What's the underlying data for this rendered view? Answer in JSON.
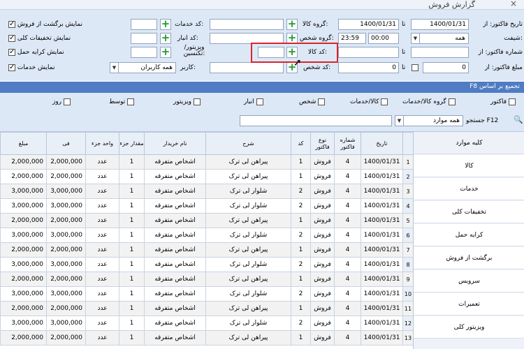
{
  "window": {
    "title": "گزارش فروش",
    "close": "×"
  },
  "filters": {
    "row1": {
      "date_label": "تاریخ فاکتور: از",
      "date_from": "1400/01/31",
      "to_label": "تا",
      "date_to": "1400/01/31",
      "product_group_label": "گروه کالا:",
      "product_group_value": "",
      "service_code_label": "کد خدمات:",
      "service_code_value": ""
    },
    "row2": {
      "shift_label": "شیفت:",
      "shift_value": "همه",
      "time_from": "00:00",
      "time_to": "23:59",
      "person_group_label": "گروه شخص:",
      "person_group_value": "",
      "warehouse_code_label": "کد انبار:",
      "warehouse_code_value": ""
    },
    "row3": {
      "invoice_no_label": "شماره فاکتور: از",
      "invoice_from": "",
      "to_label": "تا",
      "invoice_to": "",
      "product_code_label": "کد کالا:",
      "product_code_value": "",
      "visitor_label": "ویزیتور/ تکنسین:",
      "visitor_value": ""
    },
    "row4": {
      "amount_label": "مبلغ فاکتور: از",
      "amount_from": "0",
      "to_label": "تا",
      "amount_to": "0",
      "person_code_label": "کد شخص:",
      "person_code_value": "",
      "user_label": "کاربر:",
      "user_value": "همه کاربران"
    },
    "checkboxes": [
      {
        "label": "نمایش برگشت از فروش",
        "checked": true
      },
      {
        "label": "نمایش تخفیفات کلی",
        "checked": true
      },
      {
        "label": "نمایش کرایه حمل",
        "checked": true
      },
      {
        "label": "نمایش خدمات",
        "checked": true
      }
    ]
  },
  "grouping": {
    "bar_title": "F8 تجمیع بر اساس",
    "options": [
      "فاکتور",
      "گروه کالا/خدمات",
      "کالا/خدمات",
      "شخص",
      "انبار",
      "ویزیتور",
      "توسط",
      "روز"
    ]
  },
  "search": {
    "label": "جستجو F12",
    "scope": "همه موارد",
    "query": ""
  },
  "sidebar": {
    "items": [
      "کلیه موارد",
      "کالا",
      "خدمات",
      "تخفیفات کلی",
      "کرایه حمل",
      "برگشت از فروش",
      "سرویس",
      "تعمیرات",
      "ویزیتور کلی"
    ]
  },
  "table": {
    "headers": [
      "مبلغ",
      "فی",
      "واحد جزء",
      "مقدار جزء",
      "نام خریدار",
      "شرح",
      "کد",
      "نوع فاکتور",
      "شماره فاکتور",
      "تاریخ",
      ""
    ],
    "rows": [
      [
        "2,000,000",
        "2,000,000",
        "عدد",
        "1",
        "اشخاص متفرقه",
        "پیراهن لی ترک",
        "1",
        "فروش",
        "4",
        "1400/01/31",
        "1"
      ],
      [
        "2,000,000",
        "2,000,000",
        "عدد",
        "1",
        "اشخاص متفرقه",
        "پیراهن لی ترک",
        "1",
        "فروش",
        "4",
        "1400/01/31",
        "2"
      ],
      [
        "3,000,000",
        "3,000,000",
        "عدد",
        "1",
        "اشخاص متفرقه",
        "شلوار لی ترک",
        "2",
        "فروش",
        "4",
        "1400/01/31",
        "3"
      ],
      [
        "3,000,000",
        "3,000,000",
        "عدد",
        "1",
        "اشخاص متفرقه",
        "شلوار لی ترک",
        "2",
        "فروش",
        "4",
        "1400/01/31",
        "4"
      ],
      [
        "2,000,000",
        "2,000,000",
        "عدد",
        "1",
        "اشخاص متفرقه",
        "پیراهن لی ترک",
        "1",
        "فروش",
        "4",
        "1400/01/31",
        "5"
      ],
      [
        "3,000,000",
        "3,000,000",
        "عدد",
        "1",
        "اشخاص متفرقه",
        "شلوار لی ترک",
        "2",
        "فروش",
        "4",
        "1400/01/31",
        "6"
      ],
      [
        "2,000,000",
        "2,000,000",
        "عدد",
        "1",
        "اشخاص متفرقه",
        "پیراهن لی ترک",
        "1",
        "فروش",
        "4",
        "1400/01/31",
        "7"
      ],
      [
        "3,000,000",
        "3,000,000",
        "عدد",
        "1",
        "اشخاص متفرقه",
        "شلوار لی ترک",
        "2",
        "فروش",
        "4",
        "1400/01/31",
        "8"
      ],
      [
        "2,000,000",
        "2,000,000",
        "عدد",
        "1",
        "اشخاص متفرقه",
        "پیراهن لی ترک",
        "1",
        "فروش",
        "4",
        "1400/01/31",
        "9"
      ],
      [
        "3,000,000",
        "3,000,000",
        "عدد",
        "1",
        "اشخاص متفرقه",
        "شلوار لی ترک",
        "2",
        "فروش",
        "4",
        "1400/01/31",
        "10"
      ],
      [
        "2,000,000",
        "2,000,000",
        "عدد",
        "1",
        "اشخاص متفرقه",
        "پیراهن لی ترک",
        "1",
        "فروش",
        "4",
        "1400/01/31",
        "11"
      ],
      [
        "3,000,000",
        "3,000,000",
        "عدد",
        "1",
        "اشخاص متفرقه",
        "شلوار لی ترک",
        "2",
        "فروش",
        "4",
        "1400/01/31",
        "12"
      ],
      [
        "2,000,000",
        "2,000,000",
        "عدد",
        "1",
        "اشخاص متفرقه",
        "پیراهن لی ترک",
        "1",
        "فروش",
        "4",
        "1400/01/31",
        "13"
      ]
    ]
  },
  "colors": {
    "accent_bar": "#4f7cc2",
    "filter_bg": "#dde8f6",
    "add_icon": "#1e9a2e",
    "highlight_box": "#d6262b"
  }
}
